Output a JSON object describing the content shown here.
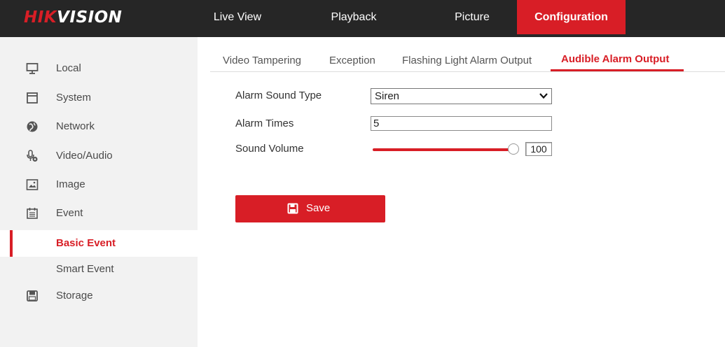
{
  "brand": {
    "part1": "HIK",
    "part2": "VISION"
  },
  "nav": {
    "live_view": "Live View",
    "playback": "Playback",
    "picture": "Picture",
    "configuration": "Configuration"
  },
  "sidebar": {
    "items": [
      {
        "label": "Local",
        "icon": "monitor-icon"
      },
      {
        "label": "System",
        "icon": "system-icon"
      },
      {
        "label": "Network",
        "icon": "globe-icon"
      },
      {
        "label": "Video/Audio",
        "icon": "microphone-icon"
      },
      {
        "label": "Image",
        "icon": "image-icon"
      },
      {
        "label": "Event",
        "icon": "calendar-icon"
      },
      {
        "label": "Storage",
        "icon": "floppy-disk-icon"
      }
    ],
    "event_sub": {
      "basic": "Basic Event",
      "smart": "Smart Event"
    }
  },
  "tabs": {
    "video_tampering": "Video Tampering",
    "exception": "Exception",
    "flashing_light": "Flashing Light Alarm Output",
    "audible_alarm": "Audible Alarm Output"
  },
  "form": {
    "sound_type_label": "Alarm Sound Type",
    "sound_type_value": "Siren",
    "alarm_times_label": "Alarm Times",
    "alarm_times_value": "5",
    "sound_volume_label": "Sound Volume",
    "sound_volume_value": "100",
    "sound_volume_level": 1.0
  },
  "save_label": "Save",
  "colors": {
    "accent": "#d81e26",
    "topbar": "#262626",
    "sidebar": "#f2f2f2"
  }
}
